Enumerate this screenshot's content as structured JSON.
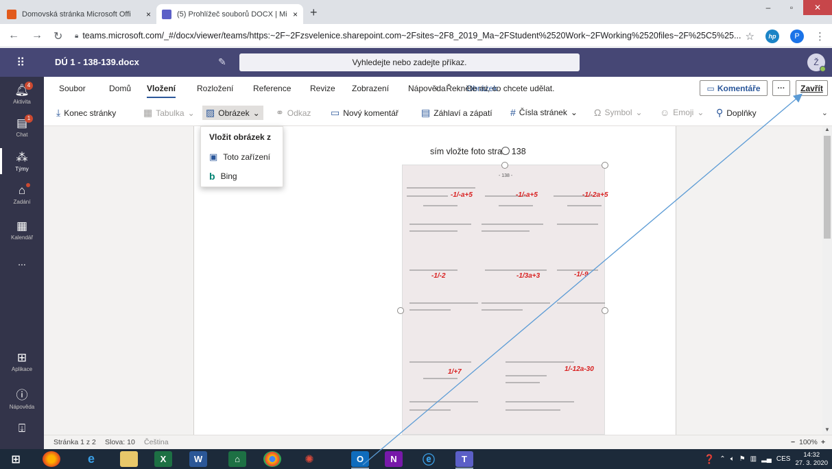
{
  "browser": {
    "tabs": [
      {
        "title": "Domovská stránka Microsoft Offi",
        "close": "×"
      },
      {
        "title": "(5) Prohlížeč souborů DOCX | Mi",
        "close": "×"
      }
    ],
    "new_tab": "+",
    "url": "teams.microsoft.com/_#/docx/viewer/teams/https:~2F~2Fzsvelenice.sharepoint.com~2Fsites~2F8_2019_Ma~2FStudent%2520Work~2FWorking%2520files~2F%25C5%25...",
    "profile_initial": "P",
    "hp_label": "hp",
    "window_controls": {
      "minimize": "–",
      "maximize": "▫",
      "close": "✕"
    }
  },
  "teams": {
    "doc_title": "DÚ 1 - 138-139.docx",
    "search_placeholder": "Vyhledejte nebo zadejte příkaz.",
    "user_initial": "Ž",
    "rail": [
      {
        "label": "Aktivita",
        "badge": "4"
      },
      {
        "label": "Chat",
        "badge": "1"
      },
      {
        "label": "Týmy",
        "badge": ""
      },
      {
        "label": "Zadání",
        "badge": ""
      },
      {
        "label": "Kalendář",
        "badge": ""
      },
      {
        "label": "...",
        "badge": ""
      },
      {
        "label": "Aplikace",
        "badge": ""
      },
      {
        "label": "Nápověda",
        "badge": ""
      }
    ]
  },
  "ribbon": {
    "tabs": [
      "Soubor",
      "Domů",
      "Vložení",
      "Rozložení",
      "Reference",
      "Revize",
      "Zobrazení",
      "Nápověda",
      "Obrázek"
    ],
    "selected_tab": "Vložení",
    "tell_me": "Řekněte mi, co chcete udělat.",
    "comments_button": "Komentáře",
    "more_button": "···",
    "close_button": "Zavřít",
    "commands": {
      "page_break": "Konec stránky",
      "table": "Tabulka",
      "picture": "Obrázek",
      "link": "Odkaz",
      "new_comment": "Nový komentář",
      "header_footer": "Záhlaví a zápatí",
      "page_numbers": "Čísla stránek",
      "symbol": "Symbol",
      "emoji": "Emoji",
      "addins": "Doplňky"
    }
  },
  "picture_menu": {
    "title": "Vložit obrázek z",
    "items": [
      "Toto zařízení",
      "Bing"
    ]
  },
  "document": {
    "text": "sím vložte foto stran. 138",
    "photo_header": "- 138 -",
    "photo_answers": [
      "-1/-a+5",
      "-1/-2a+5",
      "-1/-2",
      "-1/3a+3",
      "-1/-9",
      "1/+7",
      "1/-12a-30"
    ]
  },
  "status": {
    "page": "Stránka 1 z 2",
    "words": "Slova: 10",
    "language": "Čeština",
    "zoom": "100%",
    "zoom_minus": "−",
    "zoom_plus": "+"
  },
  "taskbar": {
    "language": "CES",
    "time": "14:32",
    "date": "27. 3. 2020"
  }
}
